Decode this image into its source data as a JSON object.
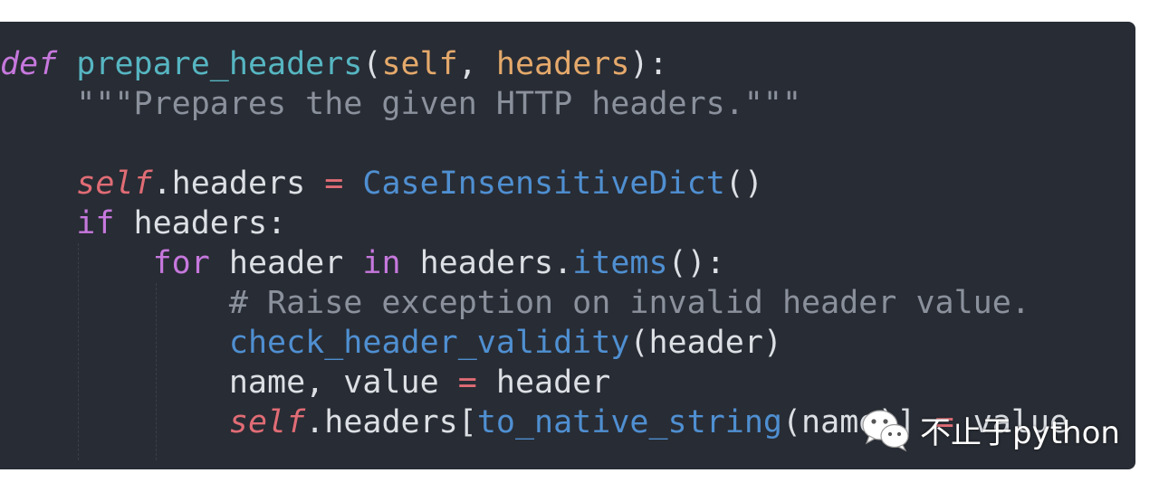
{
  "code_lines": [
    [
      {
        "t": "def",
        "c": "kw-def"
      },
      {
        "t": " ",
        "c": "plain"
      },
      {
        "t": "prepare_headers",
        "c": "fn-def"
      },
      {
        "t": "(",
        "c": "punc"
      },
      {
        "t": "self",
        "c": "param"
      },
      {
        "t": ", ",
        "c": "punc"
      },
      {
        "t": "headers",
        "c": "param"
      },
      {
        "t": "):",
        "c": "punc"
      }
    ],
    [
      {
        "t": "    \"\"\"Prepares the given HTTP headers.\"\"\"",
        "c": "docstr"
      }
    ],
    [],
    [
      {
        "t": "    ",
        "c": "plain"
      },
      {
        "t": "self",
        "c": "self"
      },
      {
        "t": ".headers ",
        "c": "plain"
      },
      {
        "t": "=",
        "c": "op"
      },
      {
        "t": " ",
        "c": "plain"
      },
      {
        "t": "CaseInsensitiveDict",
        "c": "call"
      },
      {
        "t": "()",
        "c": "punc"
      }
    ],
    [
      {
        "t": "    ",
        "c": "plain"
      },
      {
        "t": "if",
        "c": "kw"
      },
      {
        "t": " headers:",
        "c": "plain"
      }
    ],
    [
      {
        "t": "        ",
        "c": "plain"
      },
      {
        "t": "for",
        "c": "kw"
      },
      {
        "t": " header ",
        "c": "plain"
      },
      {
        "t": "in",
        "c": "kw"
      },
      {
        "t": " headers.",
        "c": "plain"
      },
      {
        "t": "items",
        "c": "call"
      },
      {
        "t": "():",
        "c": "punc"
      }
    ],
    [
      {
        "t": "            # Raise exception on invalid header value.",
        "c": "comment"
      }
    ],
    [
      {
        "t": "            ",
        "c": "plain"
      },
      {
        "t": "check_header_validity",
        "c": "call"
      },
      {
        "t": "(header)",
        "c": "punc"
      }
    ],
    [
      {
        "t": "            name, value ",
        "c": "plain"
      },
      {
        "t": "=",
        "c": "op"
      },
      {
        "t": " header",
        "c": "plain"
      }
    ],
    [
      {
        "t": "            ",
        "c": "plain"
      },
      {
        "t": "self",
        "c": "self"
      },
      {
        "t": ".headers[",
        "c": "plain"
      },
      {
        "t": "to_native_string",
        "c": "call"
      },
      {
        "t": "(name)] ",
        "c": "punc"
      },
      {
        "t": "=",
        "c": "op"
      },
      {
        "t": " value",
        "c": "plain"
      }
    ]
  ],
  "watermark": {
    "text": "不止于python",
    "icon": "wechat-icon"
  },
  "colors": {
    "background": "#282c34",
    "keyword": "#c678dd",
    "function_def": "#56b6c2",
    "parameter": "#e5a96b",
    "self": "#e06c75",
    "call": "#4f8fd1",
    "comment": "#8b919c",
    "text": "#dcdfe4"
  }
}
